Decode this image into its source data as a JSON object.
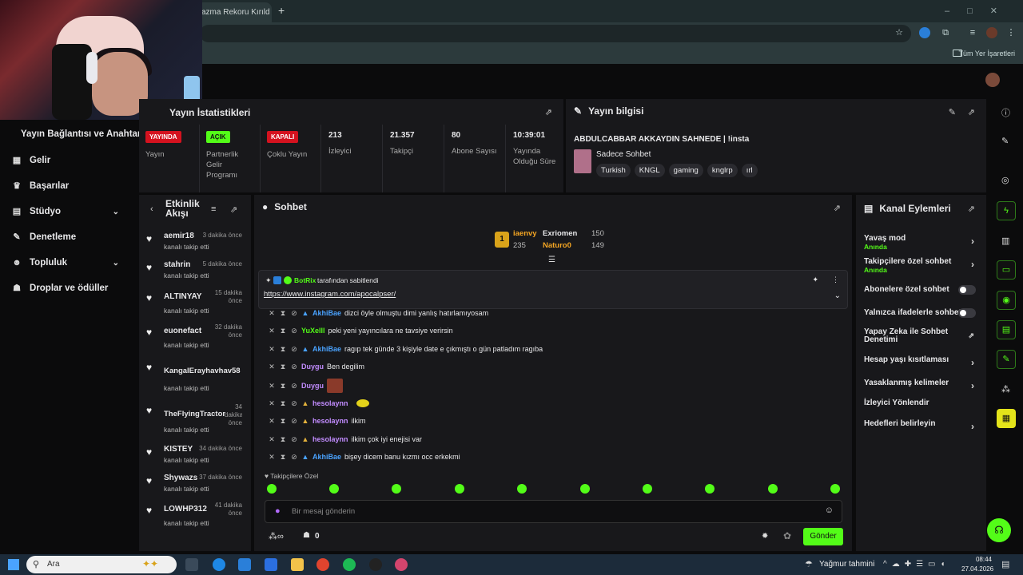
{
  "browser": {
    "tab_title": "azma Rekoru Kırıld",
    "bookmarks_label": "Tüm Yer İşaretleri"
  },
  "sidebar": {
    "title": "Yayın Bağlantısı ve Anahtarı",
    "items": [
      {
        "label": "Gelir",
        "icon": "money-icon",
        "expandable": false
      },
      {
        "label": "Başarılar",
        "icon": "trophy-icon",
        "expandable": false
      },
      {
        "label": "Stüdyo",
        "icon": "studio-icon",
        "expandable": true
      },
      {
        "label": "Denetleme",
        "icon": "wrench-icon",
        "expandable": false
      },
      {
        "label": "Topluluk",
        "icon": "people-icon",
        "expandable": true
      },
      {
        "label": "Droplar ve ödüller",
        "icon": "gift-icon",
        "expandable": false
      }
    ]
  },
  "stats": {
    "title": "Yayın İstatistikleri",
    "items": [
      {
        "badge": "YAYINDA",
        "badge_color": "#d4121f",
        "label": "Yayın"
      },
      {
        "badge": "AÇIK",
        "badge_color": "#53fc18",
        "label": "Partnerlik Gelir Programı"
      },
      {
        "badge": "KAPALI",
        "badge_color": "#d4121f",
        "label": "Çoklu Yayın"
      },
      {
        "value": "213",
        "label": "İzleyici"
      },
      {
        "value": "21.357",
        "label": "Takipçi"
      },
      {
        "value": "80",
        "label": "Abone Sayısı"
      },
      {
        "value": "10:39:01",
        "label": "Yayında Olduğu Süre"
      }
    ]
  },
  "stream_info": {
    "title": "Yayın bilgisi",
    "stream_title": "ABDULCABBAR AKKAYDIN SAHNEDE | !insta",
    "category": "Sadece Sohbet",
    "tags": [
      "Turkish",
      "KNGL",
      "gaming",
      "knglrp",
      "ırl"
    ]
  },
  "activity": {
    "title": "Etkinlik Akışı",
    "items": [
      {
        "name": "aemir18",
        "time": "3 dakika önce",
        "action": "kanalı takip etti"
      },
      {
        "name": "stahrin",
        "time": "5 dakika önce",
        "action": "kanalı takip etti"
      },
      {
        "name": "ALTINYAY",
        "time": "15 dakika önce",
        "action": "kanalı takip etti"
      },
      {
        "name": "euonefact",
        "time": "32 dakika önce",
        "action": "kanalı takip etti"
      },
      {
        "name": "KangalErayhavhav58",
        "time": "",
        "action": "kanalı takip etti"
      },
      {
        "name": "TheFlyingTractor",
        "time": "34 dakika önce",
        "action": "kanalı takip etti"
      },
      {
        "name": "KISTEY",
        "time": "34 dakika önce",
        "action": "kanalı takip etti"
      },
      {
        "name": "Shywazs",
        "time": "37 dakika önce",
        "action": "kanalı takip etti"
      },
      {
        "name": "LOWHP312",
        "time": "41 dakika önce",
        "action": "kanalı takip etti"
      }
    ]
  },
  "chat": {
    "title": "Sohbet",
    "leaders": [
      {
        "rank": "1",
        "name": "iaenvy",
        "count": "235"
      },
      {
        "name": "Exriomen",
        "count": "150"
      },
      {
        "name": "Naturo0",
        "count": "149"
      }
    ],
    "pinned_by_user": "BotRix",
    "pinned_by_text": "tarafından sabitlendi",
    "pinned_link": "https://www.instagram.com/apocalpser/",
    "messages": [
      {
        "user": "AkhiBae",
        "color": "#4aa3ff",
        "text": "dizci öyle olmuştu dimi yanlış hatırlamıyosam"
      },
      {
        "user": "YuXelll",
        "color": "#53fc18",
        "text": "peki yeni yayıncılara ne tavsiye verirsin"
      },
      {
        "user": "AkhiBae",
        "color": "#4aa3ff",
        "text": "ragıp tek günde 3 kişiyle date e çıkmıştı o gün patladım ragıba"
      },
      {
        "user": "Duygu",
        "color": "#c28cff",
        "text": "Ben degilim"
      },
      {
        "user": "Duygu",
        "color": "#c28cff",
        "text": ""
      },
      {
        "user": "hesolaynn",
        "color": "#c28cff",
        "text": ""
      },
      {
        "user": "hesolaynn",
        "color": "#c28cff",
        "text": "ilkim"
      },
      {
        "user": "hesolaynn",
        "color": "#c28cff",
        "text": "ilkim çok iyi enejisi var"
      },
      {
        "user": "AkhiBae",
        "color": "#4aa3ff",
        "text": "bişey dicem banu kızmı occ erkekmi"
      }
    ],
    "followers_only_label": "Takipçilere Özel",
    "input_placeholder": "Bir mesaj gönderin",
    "viewers_count": "0",
    "send_label": "Gönder"
  },
  "channel_actions": {
    "title": "Kanal Eylemleri",
    "items": [
      {
        "label": "Yavaş mod",
        "sub": "Anında",
        "kind": "arrow"
      },
      {
        "label": "Takipçilere özel sohbet",
        "sub": "Anında",
        "kind": "arrow"
      },
      {
        "label": "Abonelere özel sohbet",
        "sub": "",
        "kind": "toggle"
      },
      {
        "label": "Yalnızca ifadelerle sohbet",
        "sub": "",
        "kind": "toggle"
      },
      {
        "label": "Yapay Zeka ile Sohbet Denetimi",
        "sub": "",
        "kind": "external"
      },
      {
        "label": "Hesap yaşı kısıtlaması",
        "sub": "",
        "kind": "arrow"
      },
      {
        "label": "Yasaklanmış kelimeler",
        "sub": "",
        "kind": "arrow"
      },
      {
        "label": "İzleyici Yönlendir",
        "sub": "",
        "kind": "none"
      },
      {
        "label": "Hedefleri belirleyin",
        "sub": "",
        "kind": "arrow"
      }
    ]
  },
  "taskbar": {
    "search_label": "Ara",
    "weather": "Yağmur tahmini",
    "time": "08:44",
    "date": "27.04.2026"
  },
  "colors": {
    "accent": "#53fc18",
    "panel": "#18181b",
    "background": "#0b0b0c",
    "live_red": "#d4121f"
  }
}
